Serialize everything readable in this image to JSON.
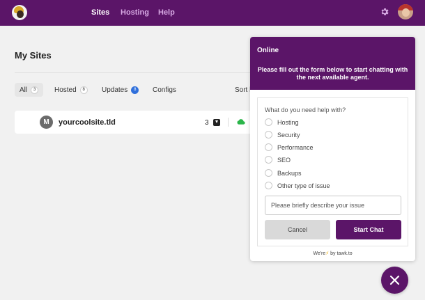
{
  "nav": {
    "sites": "Sites",
    "hosting": "Hosting",
    "help": "Help"
  },
  "page": {
    "title": "My Sites"
  },
  "filters": [
    {
      "label": "All",
      "count": "3"
    },
    {
      "label": "Hosted",
      "count": "8"
    },
    {
      "label": "Updates",
      "count": "8"
    },
    {
      "label": "Configs"
    }
  ],
  "sort_label": "Sort b",
  "site": {
    "initial": "M",
    "name": "yourcoolsite.tld",
    "count": "3"
  },
  "chat": {
    "status": "Online",
    "subtitle": "Please fill out the form below to start chatting with the next available agent.",
    "question": "What do you need help with?",
    "options": [
      "Hosting",
      "Security",
      "Performance",
      "SEO",
      "Backups",
      "Other type of issue"
    ],
    "description_placeholder": "Please briefly describe your issue",
    "cancel_label": "Cancel",
    "start_label": "Start Chat",
    "powered_prefix": "We're",
    "powered_bolt": "⚡",
    "powered_suffix": "by tawk.to"
  },
  "icons": {
    "settings": "gear-icon",
    "download": "download-icon",
    "cloud": "cloud-icon",
    "close": "close-icon"
  },
  "colors": {
    "brand": "#5b1568",
    "accent_blue": "#2f6fdb",
    "cloud_green": "#2bb54a"
  }
}
